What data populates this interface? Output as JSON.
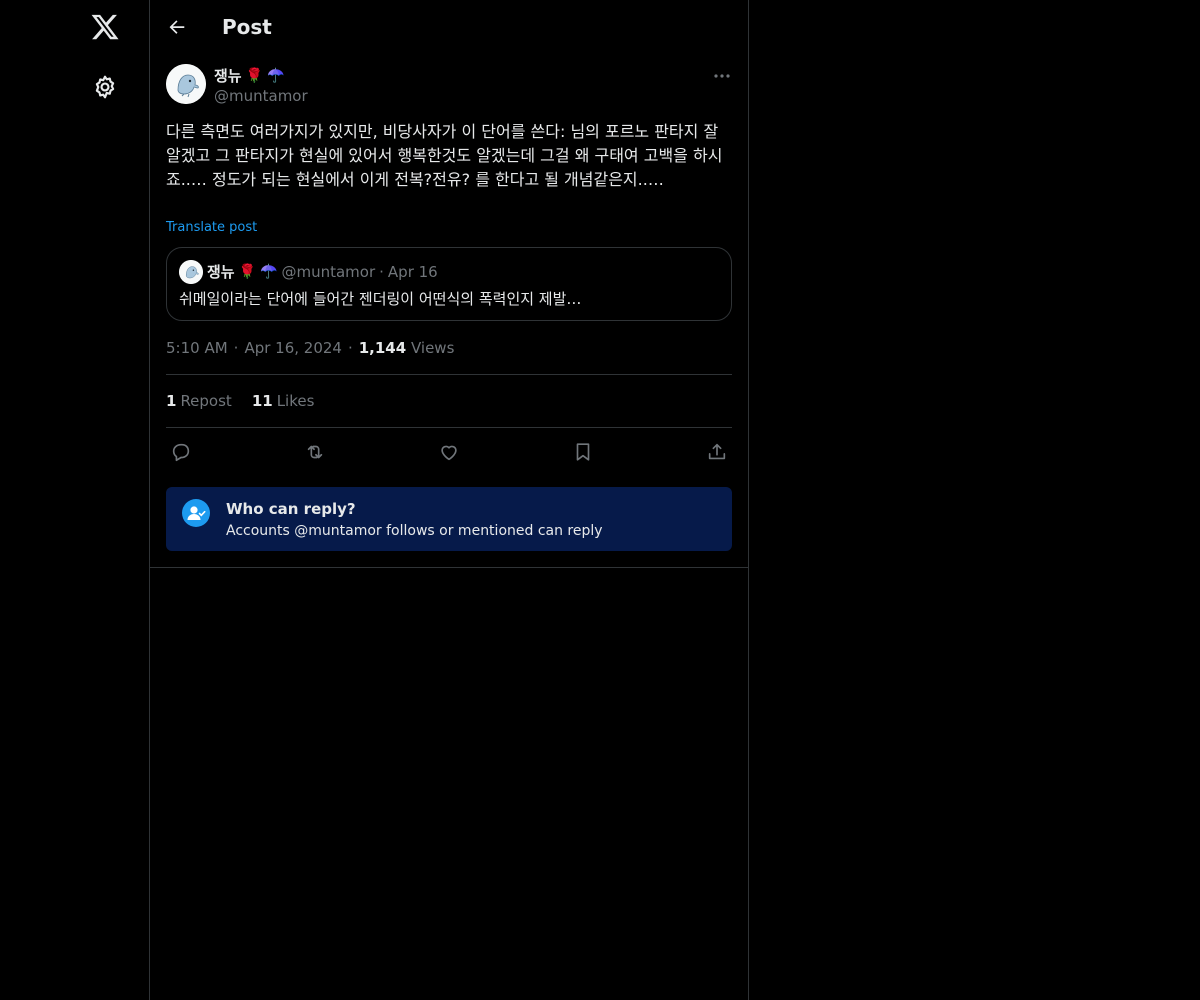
{
  "header": {
    "title": "Post"
  },
  "icons": {
    "logo": "x-logo-icon",
    "settings": "gear-icon",
    "back": "arrow-left-icon",
    "more": "more-horizontal-icon",
    "reply": "reply-icon",
    "repost": "repost-icon",
    "like": "heart-icon",
    "bookmark": "bookmark-icon",
    "share": "share-icon",
    "reply_restriction": "person-check-icon"
  },
  "post": {
    "display_name": "쟁뉴",
    "emojis": [
      "🌹",
      "☂️"
    ],
    "handle": "@muntamor",
    "text": "다른 측면도 여러가지가 있지만, 비당사자가 이 단어를 쓴다: 님의 포르노 판타지 잘 알겠고 그 판타지가 현실에 있어서 행복한것도 알겠는데 그걸 왜 구태여 고백을 하시죠..… 정도가 되는 현실에서 이게 전복?전유? 를 한다고 될 개념같은지..…",
    "translate_label": "Translate post",
    "quote": {
      "display_name": "쟁뉴",
      "emojis": [
        "🌹",
        "☂️"
      ],
      "handle": "@muntamor",
      "separator": "·",
      "date": "Apr 16",
      "text": "쉬메일이라는 단어에 들어간 젠더링이 어떤식의 폭력인지 제발…"
    },
    "time": "5:10 AM",
    "separator": "·",
    "date": "Apr 16, 2024",
    "views_count": "1,144",
    "views_label": "Views",
    "reposts_count": "1",
    "reposts_label": "Repost",
    "likes_count": "11",
    "likes_label": "Likes"
  },
  "reply_restriction": {
    "title": "Who can reply?",
    "subtitle": "Accounts @muntamor follows or mentioned can reply"
  },
  "colors": {
    "background": "#000000",
    "text": "#e7e9ea",
    "muted": "#71767b",
    "border": "#2f3336",
    "accent": "#1d9bf0",
    "reply_box": "#061a4a"
  }
}
